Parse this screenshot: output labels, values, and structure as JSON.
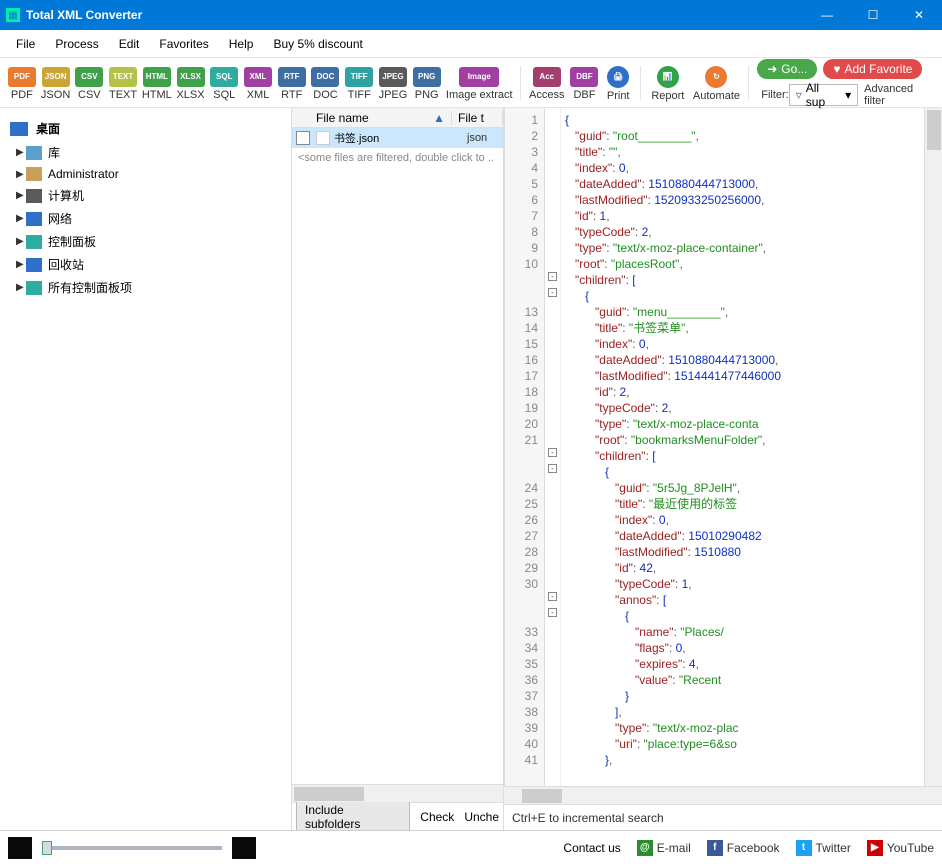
{
  "title": "Total XML Converter",
  "menus": {
    "file": "File",
    "process": "Process",
    "edit": "Edit",
    "favorites": "Favorites",
    "help": "Help",
    "discount": "Buy 5% discount"
  },
  "toolbar": {
    "pdf": "PDF",
    "json": "JSON",
    "csv": "CSV",
    "text": "TEXT",
    "html": "HTML",
    "xlsx": "XLSX",
    "sql": "SQL",
    "xml": "XML",
    "rtf": "RTF",
    "doc": "DOC",
    "tiff": "TIFF",
    "jpeg": "JPEG",
    "png": "PNG",
    "imageextract": "Image extract",
    "access": "Access",
    "dbf": "DBF",
    "print": "Print",
    "report": "Report",
    "automate": "Automate",
    "goto": "Go...",
    "addfav": "Add Favorite",
    "filter_label": "Filter:",
    "filter_value": "All sup",
    "advfilter": "Advanced filter"
  },
  "tree": {
    "root": "桌面",
    "items": [
      {
        "label": "库",
        "icon": "library"
      },
      {
        "label": "Administrator",
        "icon": "user"
      },
      {
        "label": "计算机",
        "icon": "computer"
      },
      {
        "label": "网络",
        "icon": "network"
      },
      {
        "label": "控制面板",
        "icon": "cpl"
      },
      {
        "label": "回收站",
        "icon": "recycle"
      },
      {
        "label": "所有控制面板项",
        "icon": "cpl2"
      }
    ]
  },
  "filepane": {
    "col_name": "File name",
    "col_type": "File t",
    "rows": [
      {
        "name": "书签.json",
        "ext": "json",
        "selected": true
      }
    ],
    "hint": "<some files are filtered, double click to ..",
    "btn_include": "Include subfolders",
    "btn_check": "Check",
    "btn_uncheck": "Unche"
  },
  "preview": {
    "hint": "Ctrl+E to incremental search",
    "lines": [
      {
        "n": "1",
        "html": "<span class=b>{</span>"
      },
      {
        "n": "2",
        "html": "   <span class=k>\"guid\"</span><span class=p>: </span><span class=s>\"root________\"</span><span class=p>,</span>"
      },
      {
        "n": "3",
        "html": "   <span class=k>\"title\"</span><span class=p>: </span><span class=s>\"\"</span><span class=p>,</span>"
      },
      {
        "n": "4",
        "html": "   <span class=k>\"index\"</span><span class=p>: </span><span class=n>0</span><span class=p>,</span>"
      },
      {
        "n": "5",
        "html": "   <span class=k>\"dateAdded\"</span><span class=p>: </span><span class=n>1510880444713000</span><span class=p>,</span>"
      },
      {
        "n": "6",
        "html": "   <span class=k>\"lastModified\"</span><span class=p>: </span><span class=n>1520933250256000</span><span class=p>,</span>"
      },
      {
        "n": "7",
        "html": "   <span class=k>\"id\"</span><span class=p>: </span><span class=n>1</span><span class=p>,</span>"
      },
      {
        "n": "8",
        "html": "   <span class=k>\"typeCode\"</span><span class=p>: </span><span class=n>2</span><span class=p>,</span>"
      },
      {
        "n": "9",
        "html": "   <span class=k>\"type\"</span><span class=p>: </span><span class=s>\"text/x-moz-place-container\"</span><span class=p>,</span>"
      },
      {
        "n": "10",
        "html": "   <span class=k>\"root\"</span><span class=p>: </span><span class=s>\"placesRoot\"</span><span class=p>,</span>"
      },
      {
        "n": "",
        "html": "   <span class=k>\"children\"</span><span class=p>: </span><span class=b>[</span>"
      },
      {
        "n": "",
        "html": "      <span class=b>{</span>"
      },
      {
        "n": "13",
        "html": "         <span class=k>\"guid\"</span><span class=p>: </span><span class=s>\"menu________\"</span><span class=p>,</span>"
      },
      {
        "n": "14",
        "html": "         <span class=k>\"title\"</span><span class=p>: </span><span class=s>\"书签菜单\"</span><span class=p>,</span>"
      },
      {
        "n": "15",
        "html": "         <span class=k>\"index\"</span><span class=p>: </span><span class=n>0</span><span class=p>,</span>"
      },
      {
        "n": "16",
        "html": "         <span class=k>\"dateAdded\"</span><span class=p>: </span><span class=n>1510880444713000</span><span class=p>,</span>"
      },
      {
        "n": "17",
        "html": "         <span class=k>\"lastModified\"</span><span class=p>: </span><span class=n>1514441477446000</span>"
      },
      {
        "n": "18",
        "html": "         <span class=k>\"id\"</span><span class=p>: </span><span class=n>2</span><span class=p>,</span>"
      },
      {
        "n": "19",
        "html": "         <span class=k>\"typeCode\"</span><span class=p>: </span><span class=n>2</span><span class=p>,</span>"
      },
      {
        "n": "20",
        "html": "         <span class=k>\"type\"</span><span class=p>: </span><span class=s>\"text/x-moz-place-conta</span>"
      },
      {
        "n": "21",
        "html": "         <span class=k>\"root\"</span><span class=p>: </span><span class=s>\"bookmarksMenuFolder\"</span><span class=p>,</span>"
      },
      {
        "n": "",
        "html": "         <span class=k>\"children\"</span><span class=p>: </span><span class=b>[</span>"
      },
      {
        "n": "",
        "html": "            <span class=b>{</span>"
      },
      {
        "n": "24",
        "html": "               <span class=k>\"guid\"</span><span class=p>: </span><span class=s>\"5r5Jg_8PJelH\"</span><span class=p>,</span>"
      },
      {
        "n": "25",
        "html": "               <span class=k>\"title\"</span><span class=p>: </span><span class=s>\"最近使用的标签</span>"
      },
      {
        "n": "26",
        "html": "               <span class=k>\"index\"</span><span class=p>: </span><span class=n>0</span><span class=p>,</span>"
      },
      {
        "n": "27",
        "html": "               <span class=k>\"dateAdded\"</span><span class=p>: </span><span class=n>15010290482</span>"
      },
      {
        "n": "28",
        "html": "               <span class=k>\"lastModified\"</span><span class=p>: </span><span class=n>1510880</span>"
      },
      {
        "n": "29",
        "html": "               <span class=k>\"id\"</span><span class=p>: </span><span class=n>42</span><span class=p>,</span>"
      },
      {
        "n": "30",
        "html": "               <span class=k>\"typeCode\"</span><span class=p>: </span><span class=n>1</span><span class=p>,</span>"
      },
      {
        "n": "",
        "html": "               <span class=k>\"annos\"</span><span class=p>: </span><span class=b>[</span>"
      },
      {
        "n": "",
        "html": "                  <span class=b>{</span>"
      },
      {
        "n": "33",
        "html": "                     <span class=k>\"name\"</span><span class=p>: </span><span class=s>\"Places/</span>"
      },
      {
        "n": "34",
        "html": "                     <span class=k>\"flags\"</span><span class=p>: </span><span class=n>0</span><span class=p>,</span>"
      },
      {
        "n": "35",
        "html": "                     <span class=k>\"expires\"</span><span class=p>: </span><span class=n>4</span><span class=p>,</span>"
      },
      {
        "n": "36",
        "html": "                     <span class=k>\"value\"</span><span class=p>: </span><span class=s>\"Recent</span>"
      },
      {
        "n": "37",
        "html": "                  <span class=b>}</span>"
      },
      {
        "n": "38",
        "html": "               <span class=b>]</span><span class=p>,</span>"
      },
      {
        "n": "39",
        "html": "               <span class=k>\"type\"</span><span class=p>: </span><span class=s>\"text/x-moz-plac</span>"
      },
      {
        "n": "40",
        "html": "               <span class=k>\"uri\"</span><span class=p>: </span><span class=s>\"place:type=6&so</span>"
      },
      {
        "n": "41",
        "html": "            <span class=b>}</span><span class=p>,</span>"
      }
    ]
  },
  "footer": {
    "contact": "Contact us",
    "email": "E-mail",
    "facebook": "Facebook",
    "twitter": "Twitter",
    "youtube": "YouTube"
  },
  "colors": {
    "pdf": "#e97a2f",
    "json": "#caa636",
    "csv": "#3fa24a",
    "text": "#b86a2f",
    "html": "#3fa24a",
    "xlsx": "#3fa24a",
    "sql": "#3f6fa2",
    "xml": "#a23fa2",
    "rtf": "#3f6fa2",
    "doc": "#3f6fa2",
    "tiff": "#2fa2a2",
    "jpeg": "#5a5a5a",
    "png": "#3f6fa2",
    "image": "#a23fa2",
    "access": "#a23f6f",
    "dbf": "#a23fa2",
    "print": "#2e6fc9",
    "report": "#2fa24a",
    "automate": "#e97a2f"
  }
}
